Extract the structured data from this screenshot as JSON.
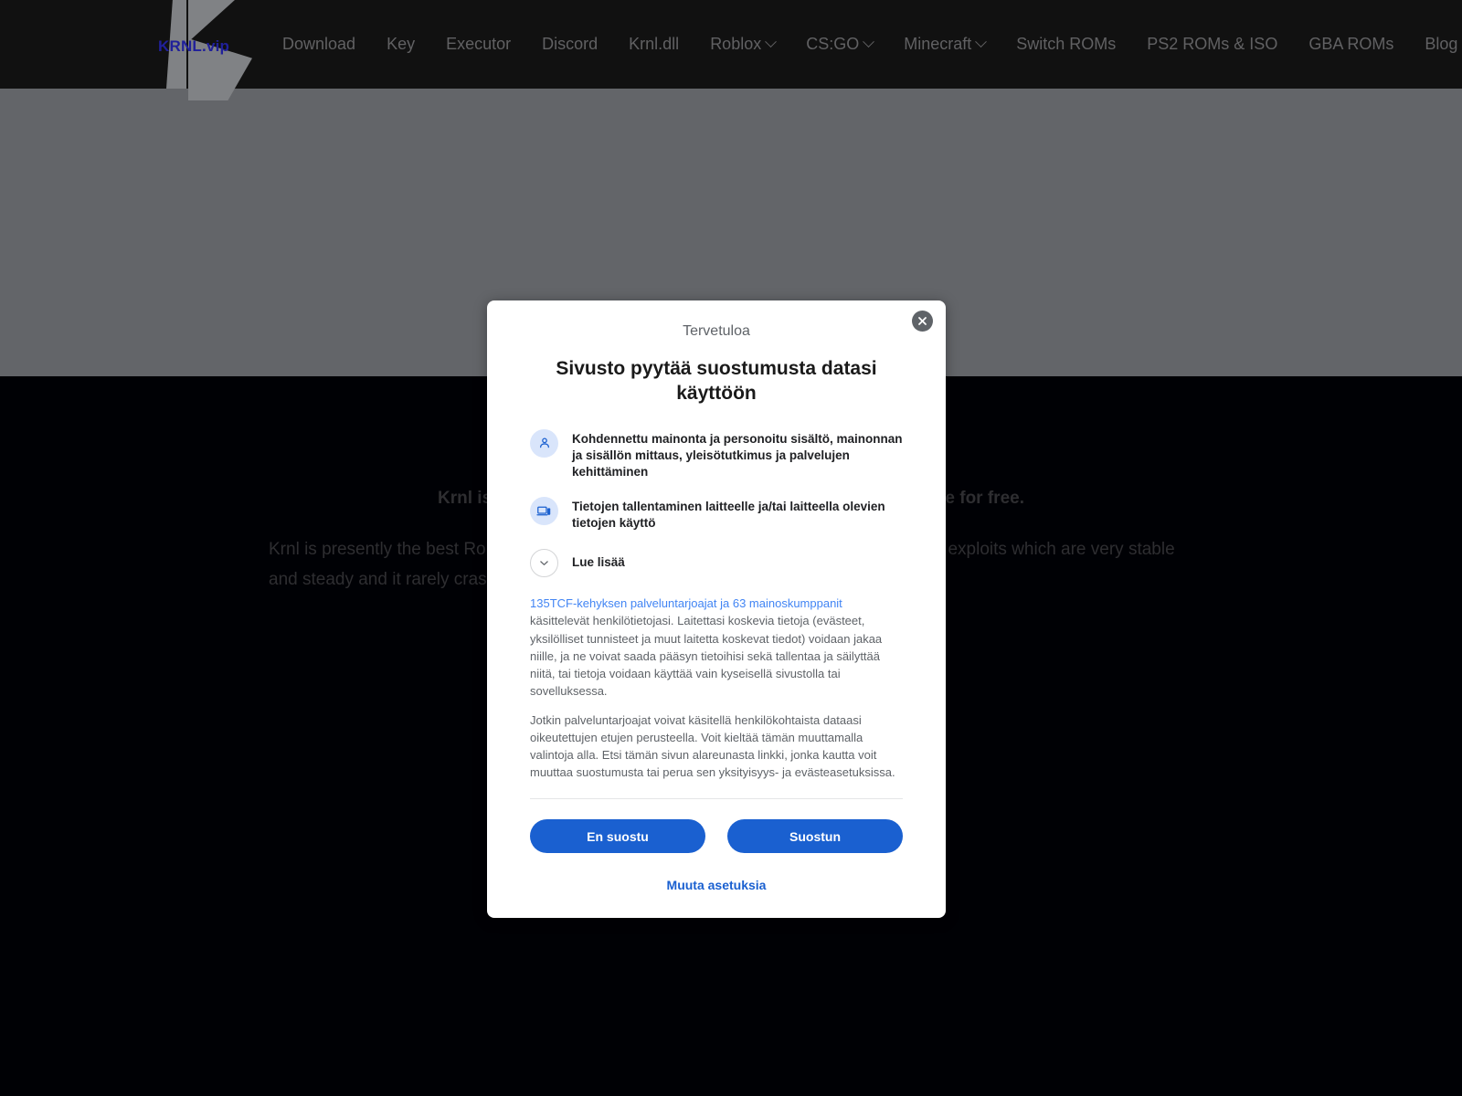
{
  "site": {
    "brand_text": "KRNL.vip",
    "nav_items": [
      {
        "label": "Download",
        "has_dropdown": false
      },
      {
        "label": "Key",
        "has_dropdown": false
      },
      {
        "label": "Executor",
        "has_dropdown": false
      },
      {
        "label": "Discord",
        "has_dropdown": false
      },
      {
        "label": "Krnl.dll",
        "has_dropdown": false
      },
      {
        "label": "Roblox",
        "has_dropdown": true
      },
      {
        "label": "CS:GO",
        "has_dropdown": true
      },
      {
        "label": "Minecraft",
        "has_dropdown": true
      },
      {
        "label": "Switch ROMs",
        "has_dropdown": false
      },
      {
        "label": "PS2 ROMs & ISO",
        "has_dropdown": false
      },
      {
        "label": "GBA ROMs",
        "has_dropdown": false
      },
      {
        "label": "Blog",
        "has_dropdown": false
      }
    ]
  },
  "content": {
    "heading": "Krnl is presently the best Roblox exploits and scripts available for free.",
    "paragraph": "Krnl is presently the best Roblox exploits and scripts available for free. Krnl is one of the exploits which are very stable and steady and it rarely crashed."
  },
  "consent_modal": {
    "eyebrow": "Tervetuloa",
    "title": "Sivusto pyytää suostumusta datasi käyttöön",
    "close_label": "Sulje",
    "purposes": [
      {
        "icon": "person-icon",
        "text": "Kohdennettu mainonta ja personoitu sisältö, mainonnan ja sisällön mittaus, yleisötutkimus ja palvelujen kehittäminen"
      },
      {
        "icon": "device-icon",
        "text": "Tietojen tallentaminen laitteelle ja/tai laitteella olevien tietojen käyttö"
      },
      {
        "icon": "chevron-down-icon",
        "text": "Lue lisää"
      }
    ],
    "body": {
      "link_text": "135TCF-kehyksen palveluntarjoajat ja 63 mainoskumppanit",
      "paragraph_1_rest": " käsittelevät henkilötietojasi. Laitettasi koskevia tietoja (evästeet, yksilölliset tunnisteet ja muut laitetta koskevat tiedot) voidaan jakaa niille, ja ne voivat saada pääsyn tietoihisi sekä tallentaa ja säilyttää niitä, tai tietoja voidaan käyttää vain kyseisellä sivustolla tai sovelluksessa.",
      "paragraph_2": "Jotkin palveluntarjoajat voivat käsitellä henkilökohtaista dataasi oikeutettujen etujen perusteella. Voit kieltää tämän muuttamalla valintoja alla. Etsi tämän sivun alareunasta linkki, jonka kautta voit muuttaa suostumusta tai perua sen yksityisyys- ja evästeasetuksissa."
    },
    "actions": {
      "decline_label": "En suostu",
      "accept_label": "Suostun",
      "settings_label": "Muuta asetuksia"
    }
  },
  "colors": {
    "accent_blue": "#1a60d0",
    "link_blue": "#4285f4",
    "header_bg": "#111111",
    "hero_bg": "#636569",
    "page_bg": "#000105",
    "close_btn": "#5f6368"
  }
}
